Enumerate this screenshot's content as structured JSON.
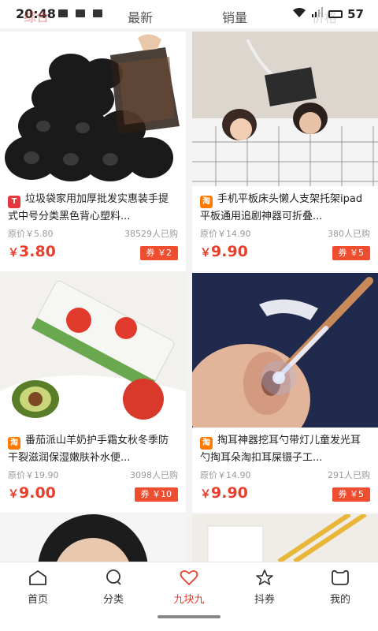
{
  "status_bar": {
    "time": "20:48",
    "battery": "57"
  },
  "sort_tabs": {
    "overlay_glyph": "综合",
    "latest": "最新",
    "sales": "销量",
    "price": "价格"
  },
  "products": [
    {
      "platform": "T",
      "platform_name": "tmall",
      "title": "垃圾袋家用加厚批发实惠装手提式中号分类黑色背心塑料...",
      "original_price": "原价￥5.80",
      "sold": "38529人已购",
      "yen": "￥",
      "price": "3.80",
      "coupon": "券 ￥2",
      "image": "black-trash-bags"
    },
    {
      "platform": "淘",
      "platform_name": "taobao",
      "title": "手机平板床头懒人支架托架ipad平板通用追剧神器可折叠...",
      "original_price": "原价￥14.90",
      "sold": "380人已购",
      "yen": "￥",
      "price": "9.90",
      "coupon": "券 ￥5",
      "image": "bed-phone-holder"
    },
    {
      "platform": "淘",
      "platform_name": "taobao",
      "title": "番茄派山羊奶护手霜女秋冬季防干裂滋润保湿嫩肤补水便...",
      "original_price": "原价￥19.90",
      "sold": "3098人已购",
      "yen": "￥",
      "price": "9.00",
      "coupon": "券 ￥10",
      "image": "hand-cream-tomato"
    },
    {
      "platform": "淘",
      "platform_name": "taobao",
      "title": "掏耳神器挖耳勺带灯儿童发光耳勺掏耳朵淘扣耳屎镊子工...",
      "original_price": "原价￥14.90",
      "sold": "291人已购",
      "yen": "￥",
      "price": "9.90",
      "coupon": "券 ￥5",
      "image": "ear-pick-light"
    }
  ],
  "nav": [
    {
      "label": "首页",
      "icon": "home-icon"
    },
    {
      "label": "分类",
      "icon": "category-icon"
    },
    {
      "label": "九块九",
      "icon": "heart-icon"
    },
    {
      "label": "抖券",
      "icon": "star-icon"
    },
    {
      "label": "我的",
      "icon": "profile-icon"
    }
  ],
  "colors": {
    "accent": "#e8402d",
    "coupon": "#ef4d30",
    "tmall": "#e4393c",
    "taobao": "#ff7a00"
  }
}
